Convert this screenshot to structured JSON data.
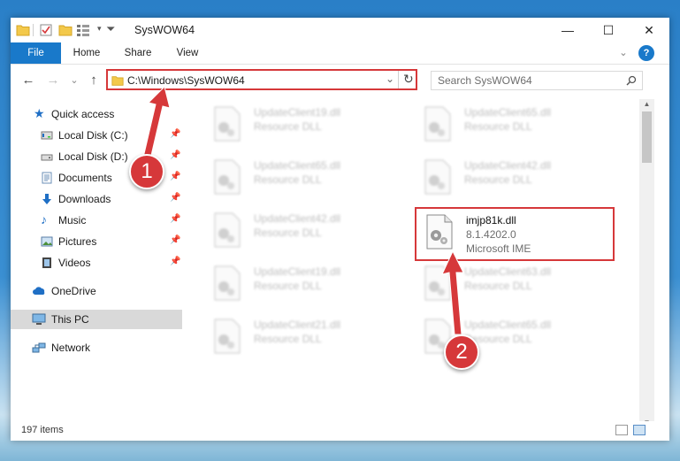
{
  "window": {
    "title": "SysWOW64",
    "controls": {
      "minimize": "—",
      "maximize": "☐",
      "close": "✕"
    }
  },
  "ribbon": {
    "tabs": [
      "File",
      "Home",
      "Share",
      "View"
    ],
    "expand": "⌄",
    "help": "?"
  },
  "nav": {
    "back": "←",
    "forward": "→",
    "recent": "⌄",
    "up": "↑",
    "address": "C:\\Windows\\SysWOW64",
    "address_dropdown": "⌄",
    "refresh": "↻",
    "search_placeholder": "Search SysWOW64"
  },
  "sidebar": {
    "items": [
      {
        "label": "Quick access",
        "icon": "star-icon",
        "color": "#1f6fc5"
      },
      {
        "label": "Local Disk (C:)",
        "icon": "drive-icon",
        "pinned": true
      },
      {
        "label": "Local Disk (D:)",
        "icon": "drive-icon",
        "pinned": true
      },
      {
        "label": "Documents",
        "icon": "documents-icon",
        "pinned": true
      },
      {
        "label": "Downloads",
        "icon": "download-icon",
        "pinned": true
      },
      {
        "label": "Music",
        "icon": "music-icon",
        "pinned": true
      },
      {
        "label": "Pictures",
        "icon": "pictures-icon",
        "pinned": true
      },
      {
        "label": "Videos",
        "icon": "videos-icon",
        "pinned": true
      },
      {
        "label": "OneDrive",
        "icon": "cloud-icon"
      },
      {
        "label": "This PC",
        "icon": "computer-icon",
        "selected": true
      },
      {
        "label": "Network",
        "icon": "network-icon"
      }
    ]
  },
  "files": [
    {
      "name": "UpdateClient19.dll",
      "type": "Resource DLL"
    },
    {
      "name": "UpdateClient65.dll",
      "type": "Resource DLL"
    },
    {
      "name": "UpdateClient65.dll",
      "type": "Resource DLL"
    },
    {
      "name": "UpdateClient42.dll",
      "type": "Resource DLL"
    },
    {
      "name": "UpdateClient42.dll",
      "type": "Resource DLL"
    },
    {
      "name": "imjp81k.dll",
      "version": "8.1.4202.0",
      "description": "Microsoft IME",
      "highlighted": true
    },
    {
      "name": "UpdateClient19.dll",
      "type": "Resource DLL"
    },
    {
      "name": "UpdateClient63.dll",
      "type": "Resource DLL"
    },
    {
      "name": "UpdateClient21.dll",
      "type": "Resource DLL"
    },
    {
      "name": "UpdateClient65.dll",
      "type": "Resource DLL"
    }
  ],
  "status": {
    "item_count": "197 items"
  },
  "annotations": {
    "step1": "1",
    "step2": "2",
    "color": "#d6383a"
  },
  "colors": {
    "accent": "#1979ca",
    "highlight": "#d6383a",
    "selected_bg": "#d9d9d9"
  }
}
